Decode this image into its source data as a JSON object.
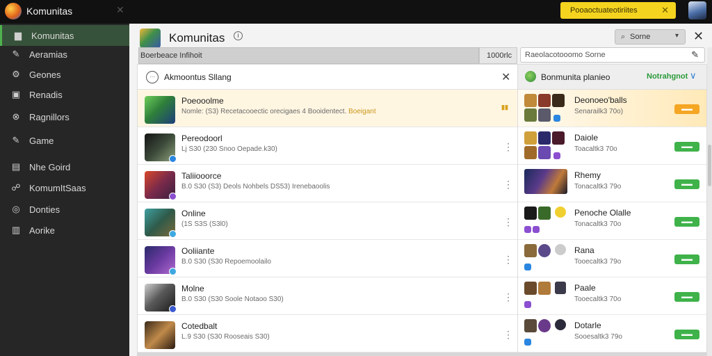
{
  "window": {
    "app_name": "Komunitas",
    "notice": "Pooaoctuateotiriites",
    "colors": {
      "accent_green": "#4fb24f",
      "notice_yellow": "#f4d41f",
      "online_green": "#2b9a3a"
    }
  },
  "sidebar": {
    "items": [
      {
        "label": "Komunitas",
        "icon": "community-icon",
        "glyph": "▆",
        "active": true
      },
      {
        "label": "Aeramias",
        "icon": "person-icon",
        "glyph": "✎",
        "active": false
      },
      {
        "label": "Geones",
        "icon": "controller-icon",
        "glyph": "⚙",
        "active": false
      },
      {
        "label": "Renadis",
        "icon": "chat-icon",
        "glyph": "▣",
        "active": false
      },
      {
        "label": "Ragnillors",
        "icon": "group-icon",
        "glyph": "⊗",
        "active": false
      },
      {
        "label": "Game",
        "icon": "game-icon",
        "glyph": "✎",
        "active": false
      },
      {
        "label": "Nhe Goird",
        "icon": "inbox-icon",
        "glyph": "▤",
        "active": false
      },
      {
        "label": "KomumItSaas",
        "icon": "people-icon",
        "glyph": "☍",
        "active": false
      },
      {
        "label": "Donties",
        "icon": "globe-icon",
        "glyph": "◎",
        "active": false
      },
      {
        "label": "Aorike",
        "icon": "library-icon",
        "glyph": "▥",
        "active": false
      }
    ]
  },
  "header": {
    "title": "Komunitas",
    "search_text": "Sorne",
    "subbar_text": "Boerbeace Infihoit",
    "count": "1000rlc",
    "right_search": "Raeolacotooomo Sorne"
  },
  "left_panel": {
    "title": "Akmoontus Sllang",
    "rows": [
      {
        "title": "Poeooolme",
        "meta": "Nomle: (S3) Recetacooectic orecigaes 4 Booidentect.",
        "hot": "Boeigant",
        "highlight": true
      },
      {
        "title": "Pereodoorl",
        "meta": "Lj S30 (230 Snoo Oepade.k30)",
        "hot": "",
        "highlight": false
      },
      {
        "title": "Taliiooorce",
        "meta": "B.0 S30 (S3) Deols Nohbels DS53) Irenebaoolis",
        "hot": "",
        "highlight": false
      },
      {
        "title": "Online",
        "meta": "(1S S3S (S3l0)",
        "hot": "",
        "highlight": false
      },
      {
        "title": "Ooliiante",
        "meta": "B.0 S30 (S30 Repoemoolailo",
        "hot": "",
        "highlight": false
      },
      {
        "title": "Molne",
        "meta": "B.0 S30 (S30 Soole Notaoo S30)",
        "hot": "",
        "highlight": false
      },
      {
        "title": "Cotedbalt",
        "meta": "L.9 S30 (S30 Rooseais S30)",
        "hot": "",
        "highlight": false
      }
    ]
  },
  "right_panel": {
    "title": "Bonmunita planieo",
    "status": "Notrahgnot",
    "friends": [
      {
        "title": "Deonoeo'balls",
        "sub": "Senarailk3 70o)",
        "tag": "▬▬",
        "tag_color": "orange",
        "highlight": true
      },
      {
        "title": "Daiole",
        "sub": "Toacaltk3 70o",
        "tag": "▬▬",
        "tag_color": "green",
        "highlight": false
      },
      {
        "title": "Rhemy",
        "sub": "Tonacaltk3 79o",
        "tag": "▬▬",
        "tag_color": "green",
        "highlight": false
      },
      {
        "title": "Penoche Olalle",
        "sub": "Tonacaltk3 70o",
        "tag": "▬▬",
        "tag_color": "green",
        "highlight": false
      },
      {
        "title": "Rana",
        "sub": "Tooecaltk3 79o",
        "tag": "▬▬",
        "tag_color": "green",
        "highlight": false
      },
      {
        "title": "Paale",
        "sub": "Tooecaltk3 70o",
        "tag": "▬▬",
        "tag_color": "green",
        "highlight": false
      },
      {
        "title": "Dotarle",
        "sub": "Sooesaltk3 79o",
        "tag": "▬▬",
        "tag_color": "green",
        "highlight": false
      }
    ]
  }
}
